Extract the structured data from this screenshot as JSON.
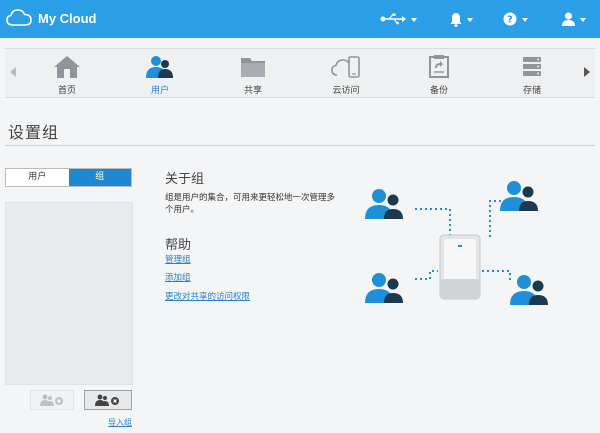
{
  "app": {
    "brand": "My Cloud"
  },
  "topbar": {
    "usb_icon": "usb-icon",
    "bell_icon": "bell-icon",
    "help_icon": "help-icon",
    "user_icon": "user-icon"
  },
  "nav": {
    "items": [
      {
        "label": "首页",
        "icon": "home-icon"
      },
      {
        "label": "用户",
        "icon": "users-icon",
        "active": true
      },
      {
        "label": "共享",
        "icon": "folder-icon"
      },
      {
        "label": "云访问",
        "icon": "cloud-device-icon"
      },
      {
        "label": "备份",
        "icon": "backup-icon"
      },
      {
        "label": "存储",
        "icon": "storage-icon"
      }
    ]
  },
  "page": {
    "title": "设置组"
  },
  "segment": {
    "users_label": "用户",
    "groups_label": "组"
  },
  "about": {
    "heading": "关于组",
    "text": "组是用户的集合，可用来更轻松地一次管理多个用户。"
  },
  "help": {
    "heading": "帮助",
    "links": [
      "管理组",
      "添加组",
      "更改对共享的访问权限"
    ]
  },
  "import_label": "导入组",
  "colors": {
    "accent": "#2a9ee6",
    "person": "#1e8fd8",
    "dark_person": "#1b3a52"
  }
}
